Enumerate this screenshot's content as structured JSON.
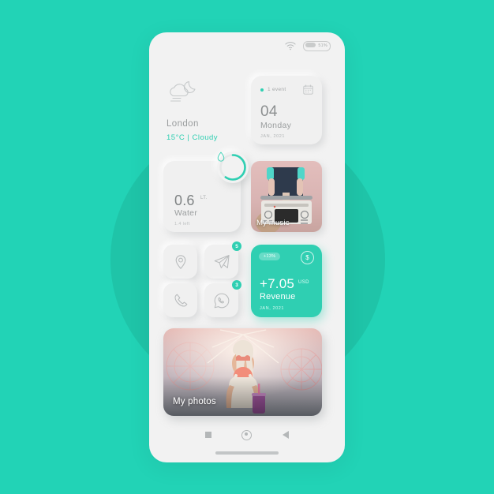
{
  "theme": {
    "background": "#22D3B6",
    "background_circle": "#1FC4A8",
    "phone_surface": "#F2F2F2",
    "card_surface": "#F0F0F0",
    "accent": "#2FCFB2",
    "text_primary": "#8C8F90",
    "text_secondary": "#9A9D9E",
    "text_muted": "#BDC0C1"
  },
  "statusbar": {
    "wifi_icon": "wifi-icon",
    "battery_icon": "battery-icon",
    "battery_level": "51%"
  },
  "weather": {
    "icon": "cloud-moon-icon",
    "city": "London",
    "condition": "15°C  |  Cloudy"
  },
  "calendar": {
    "event_label": "1 event",
    "icon": "calendar-icon",
    "day_number": "04",
    "weekday": "Monday",
    "month_year": "JAN, 2021"
  },
  "water": {
    "icon": "water-drop-icon",
    "amount": "0.6",
    "unit": "LT.",
    "label": "Water",
    "remaining": "1.4 left",
    "progress_percent": 60
  },
  "music": {
    "caption": "My music",
    "image_alt": "person holding a boombox"
  },
  "apps": [
    {
      "name": "location-app",
      "icon": "map-pin-icon",
      "badge": ""
    },
    {
      "name": "telegram-app",
      "icon": "send-plane-icon",
      "badge": "5"
    },
    {
      "name": "phone-app",
      "icon": "phone-handset-icon",
      "badge": ""
    },
    {
      "name": "whatsapp-app",
      "icon": "whatsapp-icon",
      "badge": "3"
    }
  ],
  "revenue": {
    "change_badge": "+13%",
    "coin_icon": "dollar-coin-icon",
    "amount": "+7.05",
    "currency": "USD",
    "label": "Revenue",
    "date": "JAN, 2021"
  },
  "photos": {
    "caption": "My photos",
    "image_alt": "woman with sunglasses in front of a ferris wheel at sunset"
  },
  "navbar": {
    "recents_icon": "square-recents-icon",
    "home_icon": "circle-home-icon",
    "back_icon": "triangle-back-icon",
    "home_indicator": "home-indicator"
  }
}
